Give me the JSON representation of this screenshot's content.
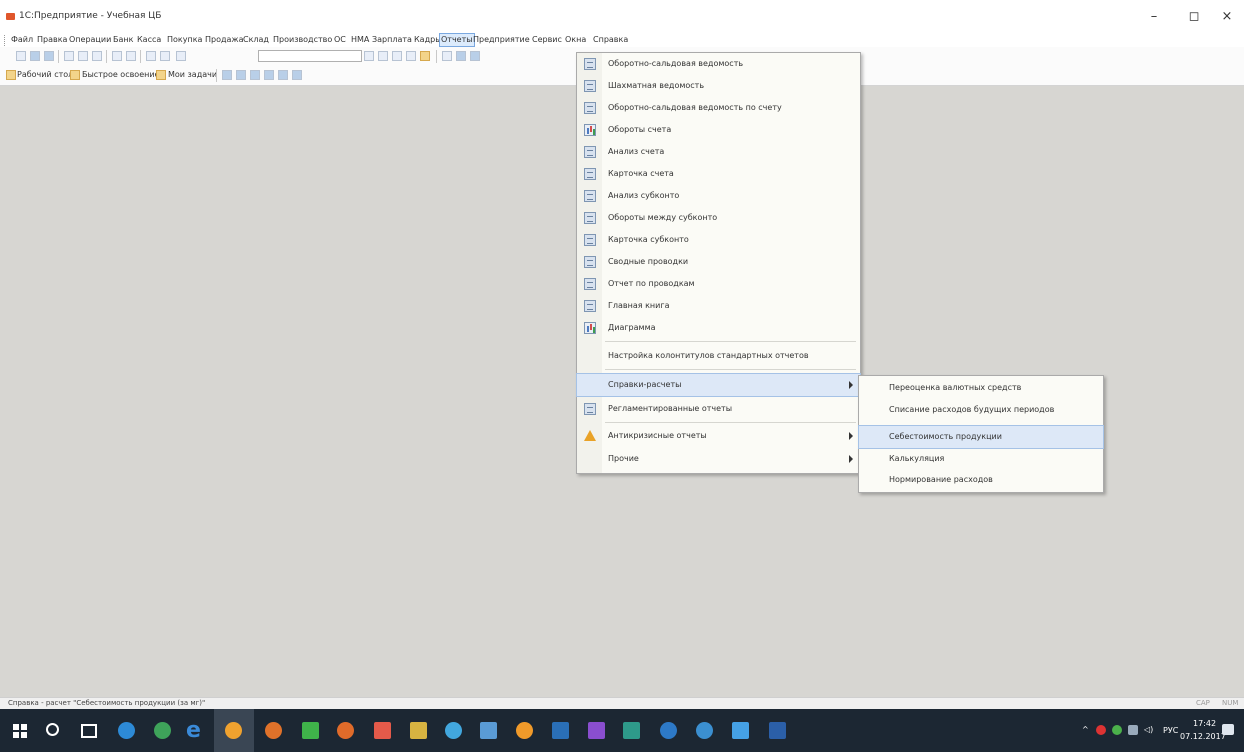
{
  "window": {
    "title": "1С:Предприятие - Учебная ЦБ",
    "controls": {
      "minimize": "–",
      "maximize": "◻",
      "close": "×"
    }
  },
  "menubar": {
    "items": [
      "Файл",
      "Правка",
      "Операции",
      "Банк",
      "Касса",
      "Покупка",
      "Продажа",
      "Склад",
      "Производство",
      "ОС",
      "НМА",
      "Зарплата",
      "Кадры",
      "Отчеты",
      "Предприятие",
      "Сервис",
      "Окна",
      "Справка"
    ],
    "active_index": 13
  },
  "toolbar2": {
    "desktop_label": "Рабочий стол",
    "quickstart_label": "Быстрое освоение",
    "tasks_label": "Мои задачи"
  },
  "reports_menu": {
    "items": [
      {
        "label": "Оборотно-сальдовая ведомость",
        "icon": "table-icon"
      },
      {
        "label": "Шахматная ведомость",
        "icon": "table-icon"
      },
      {
        "label": "Оборотно-сальдовая ведомость по счету",
        "icon": "table-icon"
      },
      {
        "label": "Обороты счета",
        "icon": "chart-icon"
      },
      {
        "label": "Анализ счета",
        "icon": "table-icon"
      },
      {
        "label": "Карточка счета",
        "icon": "table-icon"
      },
      {
        "label": "Анализ субконто",
        "icon": "table-icon"
      },
      {
        "label": "Обороты между субконто",
        "icon": "table-icon"
      },
      {
        "label": "Карточка субконто",
        "icon": "table-icon"
      },
      {
        "label": "Сводные проводки",
        "icon": "table-icon"
      },
      {
        "label": "Отчет по проводкам",
        "icon": "table-icon"
      },
      {
        "label": "Главная книга",
        "icon": "table-icon"
      },
      {
        "label": "Диаграмма",
        "icon": "chart-icon"
      },
      {
        "label": "Настройка колонтитулов стандартных отчетов",
        "icon": ""
      },
      {
        "label": "Справки-расчеты",
        "icon": "",
        "submenu": true,
        "highlighted": true
      },
      {
        "label": "Регламентированные отчеты",
        "icon": "table-icon"
      },
      {
        "label": "Антикризисные отчеты",
        "icon": "warning-icon",
        "submenu": true
      },
      {
        "label": "Прочие",
        "icon": "",
        "submenu": true
      }
    ]
  },
  "calc_submenu": {
    "items": [
      {
        "label": "Переоценка валютных средств"
      },
      {
        "label": "Списание расходов будущих периодов"
      },
      {
        "label": "Себестоимость продукции",
        "highlighted": true
      },
      {
        "label": "Калькуляция"
      },
      {
        "label": "Нормирование расходов"
      }
    ]
  },
  "statusbar": {
    "message": "Справка - расчет \"Себестоимость продукции (за мг)\"",
    "cap": "CAP",
    "num": "NUM"
  },
  "taskbar": {
    "language": "РУС",
    "time": "17:42",
    "date": "07.12.2017"
  }
}
